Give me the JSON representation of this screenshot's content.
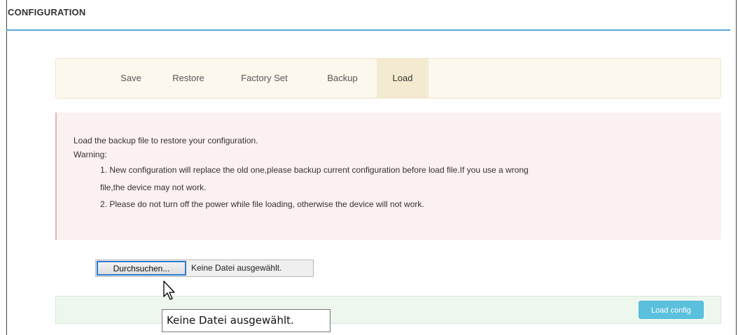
{
  "page": {
    "title": "CONFIGURATION"
  },
  "tabs": [
    {
      "label": "Save",
      "active": false
    },
    {
      "label": "Restore",
      "active": false
    },
    {
      "label": "Factory Set",
      "active": false
    },
    {
      "label": "Backup",
      "active": false
    },
    {
      "label": "Load",
      "active": true
    }
  ],
  "notice": {
    "intro": "Load the backup file to restore your configuration.",
    "warning_label": "Warning:",
    "item1_line1": "1. New configuration will replace the old one,please backup current configuration before load file.If you use a wrong",
    "item1_line2": "file,the device may not work.",
    "item2": "2. Please do not turn off the power while file loading, otherwise the device will not work."
  },
  "file_input": {
    "browse_label": "Durchsuchen...",
    "status": "Keine Datei ausgewählt."
  },
  "actions": {
    "load_label": "Load config"
  },
  "tooltip": {
    "text": "Keine Datei ausgewählt."
  },
  "colors": {
    "title_rule": "#5aa6d6",
    "tab_bar_bg": "#fcf8ee",
    "notice_bg": "#fcf1f1",
    "action_bar_bg": "#eef7ee",
    "load_button": "#5bc0de",
    "focus_border": "#2b7bd1"
  },
  "cursor": {
    "icon": "mouse-pointer-icon"
  }
}
